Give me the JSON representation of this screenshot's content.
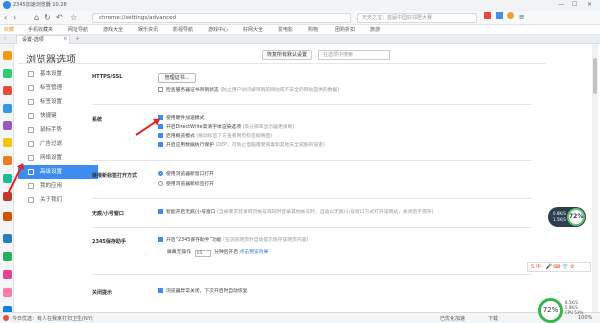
{
  "window": {
    "title": "2345加速浏览器 10.28",
    "controls": [
      "—",
      "☐",
      "✕"
    ]
  },
  "nav": {
    "url": "chrome://settings/advanced",
    "search_placeholder": "天天之宝：首届中国好邻居大赛"
  },
  "bookmarks": [
    "收藏",
    "手机收藏夹",
    "网址导航",
    "游戏大全",
    "娱乐资讯",
    "影视导航",
    "游戏中心",
    "好网大全",
    "爱电影",
    "购物",
    "团购折扣",
    "旅游"
  ],
  "tab": {
    "label": "设置-选项"
  },
  "settings": {
    "title": "浏览器选项",
    "restore_button": "恢复所有默认设置",
    "search_placeholder": "在选项中搜索",
    "nav": [
      "基本设置",
      "标签管理",
      "标签设置",
      "快捷键",
      "鼠标手势",
      "广告过滤",
      "网络设置",
      "高级设置",
      "我的应用",
      "关于我们"
    ],
    "active_nav": "高级设置",
    "sections": {
      "https": {
        "label": "HTTPS/SSL",
        "button": "管理证书...",
        "check": "检查服务器证书吊销状态",
        "note": "(防止用户访问被吊销的网站或不安全的网站提供的数据)"
      },
      "system": {
        "label": "系统",
        "items": [
          {
            "text": "使用硬件加速模式",
            "note": "",
            "checked": true
          },
          {
            "text": "开启DirectWrite高清字体渲染选项",
            "note": "(高分辨率显示器更清晰)",
            "checked": true
          },
          {
            "text": "启用概览模式",
            "note": "(拖动标签下方查看网页标签缩略图)",
            "checked": true
          },
          {
            "text": "开启应用数据执行保护",
            "note": "(DEP，可防止电脑遭受病毒和其他安全威胁的侵害)",
            "checked": true
          }
        ]
      },
      "open_mode": {
        "label": "链接新标签打开方式",
        "options": [
          {
            "text": "使用浏览器新窗口打开",
            "selected": true
          },
          {
            "text": "使用浏览器新标签打开",
            "selected": false
          }
        ]
      },
      "small_window": {
        "label": "无痕/小号窗口",
        "text": "智能开启无痕/小号窗口",
        "note": "(当被要求登录网页帐号或同时登录其他帐号时，自动以无痕/小号窗口方式打开该网站，关闭后不保存)"
      },
      "assistant": {
        "label": "2345保存助手",
        "text": "开启“2345保存助手”功能",
        "note": "(在浏览网页时自动提示保存该网页内容)",
        "delay_label": "屏幕无操作",
        "delay_value": "15",
        "delay_suffix": "分钟后开启",
        "link": "点击预览效果"
      },
      "close_warn": {
        "label": "关闭提示",
        "text": "浏览器异常关闭，下次开启时自动恢复"
      }
    }
  },
  "status": {
    "left": "今日优选：有人在我家打扫卫生(NY)",
    "items": [
      "已优化加速",
      "下载"
    ],
    "zoom": "100%"
  },
  "widget": {
    "percent": "72%",
    "up": "0.8K/S",
    "down": "1.5K/S"
  },
  "ime": {
    "label": "S 中 · 🎤 ⌨ 👕 ⚙"
  },
  "perf": {
    "percent": "72%",
    "cpu": "CPU 53%",
    "net": "8.5K/S",
    "mem": "5.8K/S"
  },
  "colors": {
    "accent": "#3d8df0",
    "arrow": "#e32626",
    "gauge": "#39b54a"
  }
}
